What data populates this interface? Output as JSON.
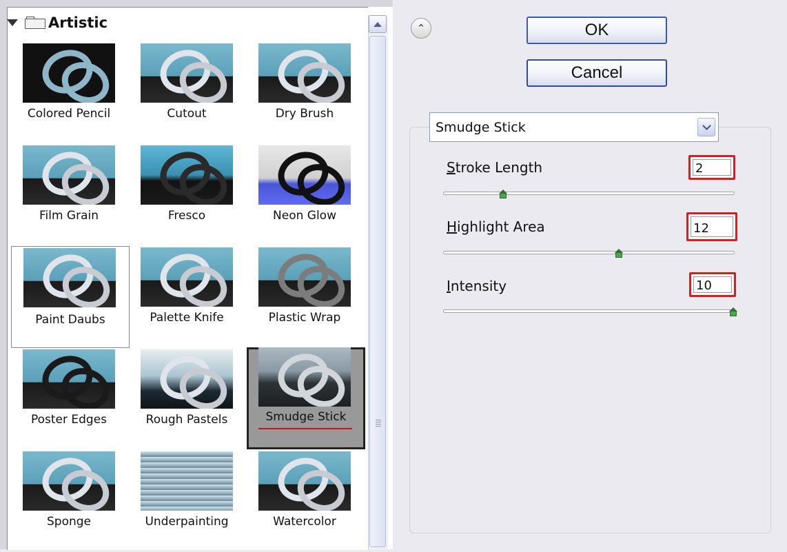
{
  "gallery": {
    "group_title": "Artistic",
    "filters": [
      {
        "label": "Colored Pencil",
        "icon": "colored-pencil-thumbnail"
      },
      {
        "label": "Cutout",
        "icon": "cutout-thumbnail"
      },
      {
        "label": "Dry Brush",
        "icon": "dry-brush-thumbnail"
      },
      {
        "label": "Film Grain",
        "icon": "film-grain-thumbnail"
      },
      {
        "label": "Fresco",
        "icon": "fresco-thumbnail"
      },
      {
        "label": "Neon Glow",
        "icon": "neon-glow-thumbnail"
      },
      {
        "label": "Paint Daubs",
        "icon": "paint-daubs-thumbnail"
      },
      {
        "label": "Palette Knife",
        "icon": "palette-knife-thumbnail"
      },
      {
        "label": "Plastic Wrap",
        "icon": "plastic-wrap-thumbnail"
      },
      {
        "label": "Poster Edges",
        "icon": "poster-edges-thumbnail"
      },
      {
        "label": "Rough Pastels",
        "icon": "rough-pastels-thumbnail"
      },
      {
        "label": "Smudge Stick",
        "icon": "smudge-stick-thumbnail"
      },
      {
        "label": "Sponge",
        "icon": "sponge-thumbnail"
      },
      {
        "label": "Underpainting",
        "icon": "underpainting-thumbnail"
      },
      {
        "label": "Watercolor",
        "icon": "watercolor-thumbnail"
      }
    ],
    "selected": "Smudge Stick"
  },
  "buttons": {
    "ok": "OK",
    "cancel": "Cancel",
    "collapse_icon": "double-chevron-up-icon"
  },
  "settings": {
    "filter_name": "Smudge Stick",
    "params": [
      {
        "label_underlined": "S",
        "label_rest": "troke Length",
        "value": "2",
        "level": 0.2
      },
      {
        "label_underlined": "H",
        "label_rest": "ighlight Area",
        "value": "12",
        "level": 0.6
      },
      {
        "label_underlined": "I",
        "label_rest": "ntensity",
        "value": "10",
        "level": 1.0
      }
    ]
  },
  "colors": {
    "highlight_box": "#d42020",
    "slider_thumb": "#49a84a",
    "button_border": "#3b5aa7"
  }
}
